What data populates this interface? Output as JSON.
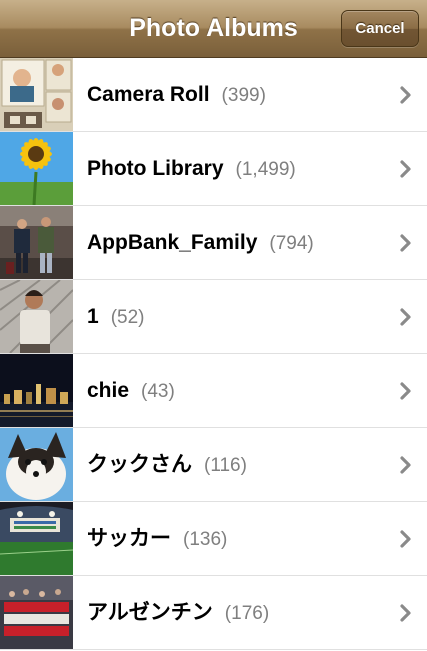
{
  "navbar": {
    "title": "Photo Albums",
    "cancel_label": "Cancel"
  },
  "albums": [
    {
      "name": "Camera Roll",
      "count": "(399)"
    },
    {
      "name": "Photo Library",
      "count": "(1,499)"
    },
    {
      "name": "AppBank_Family",
      "count": "(794)"
    },
    {
      "name": "1",
      "count": "(52)"
    },
    {
      "name": "chie",
      "count": "(43)"
    },
    {
      "name": "クックさん",
      "count": "(116)"
    },
    {
      "name": "サッカー",
      "count": "(136)"
    },
    {
      "name": "アルゼンチン",
      "count": "(176)"
    }
  ],
  "icons": {
    "row_disclosure": "chevron-right-icon"
  },
  "colors": {
    "navbar": "#a88b60",
    "count_text": "#7f7f7f",
    "chevron": "#8a8a8a"
  }
}
